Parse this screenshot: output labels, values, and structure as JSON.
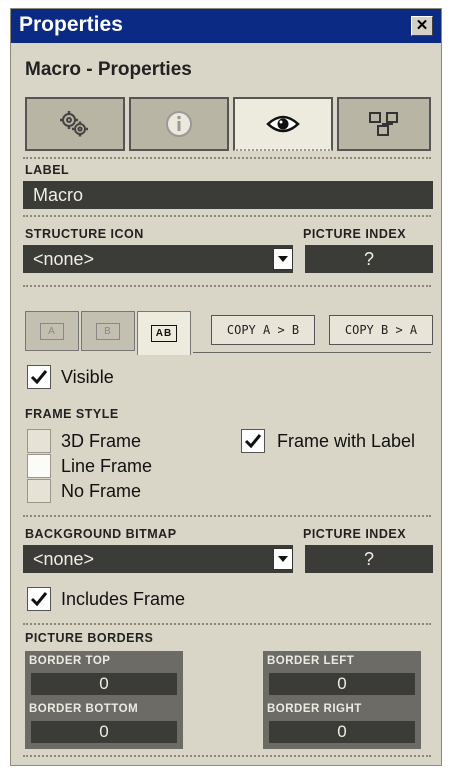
{
  "window": {
    "title": "Properties",
    "close_glyph": "✕"
  },
  "header": {
    "subtitle": "Macro - Properties"
  },
  "tabs": [
    {
      "icon": "gears-icon",
      "active": false
    },
    {
      "icon": "info-icon",
      "active": false
    },
    {
      "icon": "eye-icon",
      "active": true
    },
    {
      "icon": "structure-icon",
      "active": false
    }
  ],
  "label_section": {
    "label": "LABEL",
    "value": "Macro"
  },
  "structure_section": {
    "icon_label": "STRUCTURE ICON",
    "icon_value": "<none>",
    "picture_index_label": "PICTURE INDEX",
    "picture_index_value": "?"
  },
  "subtabs": [
    {
      "glyph": "A",
      "active": false
    },
    {
      "glyph": "B",
      "active": false
    },
    {
      "glyph": "AB",
      "active": true
    }
  ],
  "copy_buttons": {
    "a_to_b": "COPY A > B",
    "b_to_a": "COPY B > A"
  },
  "visible": {
    "label": "Visible",
    "checked": true
  },
  "frame_style": {
    "label": "FRAME STYLE",
    "options": [
      {
        "label": "3D Frame",
        "checked": false
      },
      {
        "label": "Line Frame",
        "checked": false
      },
      {
        "label": "No Frame",
        "checked": false
      }
    ],
    "frame_with_label": {
      "label": "Frame with Label",
      "checked": true
    }
  },
  "background_section": {
    "bitmap_label": "BACKGROUND BITMAP",
    "bitmap_value": "<none>",
    "picture_index_label": "PICTURE INDEX",
    "picture_index_value": "?",
    "includes_frame": {
      "label": "Includes Frame",
      "checked": true
    }
  },
  "picture_borders": {
    "label": "PICTURE BORDERS",
    "top": {
      "label": "BORDER TOP",
      "value": "0"
    },
    "bottom": {
      "label": "BORDER BOTTOM",
      "value": "0"
    },
    "left": {
      "label": "BORDER LEFT",
      "value": "0"
    },
    "right": {
      "label": "BORDER RIGHT",
      "value": "0"
    }
  },
  "colors": {
    "titlebar": "#0a2a84",
    "panel": "#d9d6c7",
    "field": "#3b3b38"
  }
}
